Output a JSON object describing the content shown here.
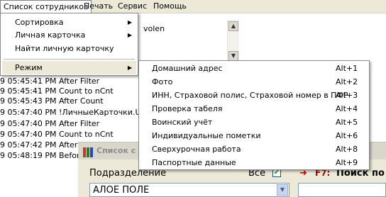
{
  "menubar": {
    "items": [
      "Список сотрудников",
      "Печать",
      "Сервис",
      "Помощь"
    ]
  },
  "main_menu": {
    "items": [
      {
        "label": "Сортировка",
        "has_submenu": true
      },
      {
        "label": "Личная карточка",
        "has_submenu": true
      },
      {
        "label": "Найти личную карточку",
        "has_submenu": false
      },
      {
        "label": "Режим",
        "has_submenu": true,
        "selected": true
      }
    ]
  },
  "submenu": {
    "items": [
      {
        "label": "Домашний адрес",
        "shortcut": "Alt+1"
      },
      {
        "label": "Фото",
        "shortcut": "Alt+2"
      },
      {
        "label": "ИНН, Страховой полис, Страховой номер в ПФР",
        "shortcut": "Alt+3"
      },
      {
        "label": "Проверка табеля",
        "shortcut": "Alt+4"
      },
      {
        "label": "Воинский учёт",
        "shortcut": "Alt+5"
      },
      {
        "label": "Индивидуальные пометки",
        "shortcut": "Alt+6"
      },
      {
        "label": "Сверхурочная работа",
        "shortcut": "Alt+8"
      },
      {
        "label": "Паспортные данные",
        "shortcut": "Alt+9"
      }
    ]
  },
  "background": {
    "list_fragment": "volen",
    "log_lines": [
      "9 05:45:41 PM After Filter",
      "9 05:45:41 PM Count to nCnt",
      "9 05:45:43 PM After Count",
      "9 05:47:40 PM !ЛичныеКарточки.U",
      "9 05:47:40 PM After Filter",
      "9 05:47:40 PM Count to nCnt",
      "9 05:47:42 PM After C",
      "9 05:48:19 PM Befor"
    ]
  },
  "inner_window": {
    "title": "Список с",
    "dept_label": "Подразделение",
    "dept_value": "АЛОЕ ПОЛЕ",
    "all_label": "Все",
    "all_checked": true,
    "search_arrow": "➜",
    "search_key": "F7:",
    "search_label": "Поиск по"
  },
  "colors": {
    "menu_bg": "#ece9d8",
    "selected_item_bg": "#ece9d8",
    "search_key": "#a00000"
  }
}
